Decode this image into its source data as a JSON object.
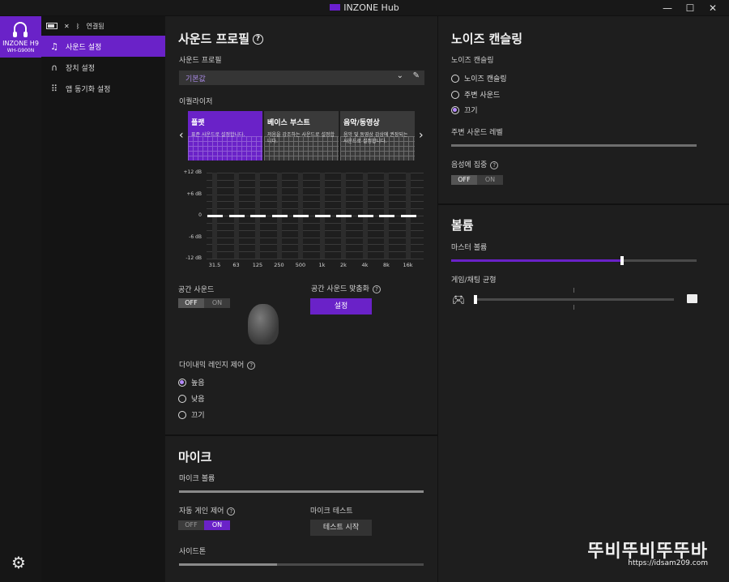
{
  "window": {
    "title": "INZONE Hub",
    "controls": [
      "—",
      "☐",
      "✕"
    ]
  },
  "device": {
    "name": "INZONE H9",
    "model": "WH-G900N"
  },
  "status": {
    "connected": "연결됨"
  },
  "nav": [
    {
      "label": "사운드 설정",
      "icon": "music-note-icon",
      "active": true
    },
    {
      "label": "장치 설정",
      "icon": "headphone-icon",
      "active": false
    },
    {
      "label": "앱 동기화 설정",
      "icon": "grid-icon",
      "active": false
    }
  ],
  "sound_profile": {
    "title": "사운드 프로필",
    "profile_label": "사운드 프로필",
    "profile_value": "기본값",
    "equalizer_label": "이퀄라이저",
    "cards": [
      {
        "title": "플랫",
        "desc": "표준 사운드로 설정합니다.",
        "selected": true
      },
      {
        "title": "베이스 부스트",
        "desc": "저음을 강조하는 사운드로 설정합니다.",
        "selected": false
      },
      {
        "title": "음악/동영상",
        "desc": "음악 및 동영상 감상에 권장되는 사운드로 설정합니다.",
        "selected": false
      }
    ],
    "eq_y_labels": [
      "+12 dB",
      "+6 dB",
      "0",
      "-6 dB",
      "-12 dB"
    ],
    "eq_bands": [
      "31.5",
      "63",
      "125",
      "250",
      "500",
      "1k",
      "2k",
      "4k",
      "8k",
      "16k"
    ],
    "eq_values_db": [
      0,
      0,
      0,
      0,
      0,
      0,
      0,
      0,
      0,
      0
    ],
    "spatial_label": "공간 사운드",
    "spatial_toggle": {
      "off": "OFF",
      "on": "ON",
      "state": "off"
    },
    "spatial_opt_label": "공간 사운드 맞춤화",
    "spatial_opt_button": "설정",
    "drc_label": "다이내믹 레인지 제어",
    "drc_options": [
      "높음",
      "낮음",
      "끄기"
    ],
    "drc_selected": 0
  },
  "mic": {
    "title": "마이크",
    "volume_label": "마이크 볼륨",
    "volume_level": 1.0,
    "agc_label": "자동 게인 제어",
    "agc_toggle": {
      "off": "OFF",
      "on": "ON",
      "state": "on"
    },
    "test_label": "마이크 테스트",
    "test_button": "테스트 시작",
    "sidetone_label": "사이드톤",
    "sidetone_level": 0.4
  },
  "noise_canceling": {
    "title": "노이즈 캔슬링",
    "label": "노이즈 캔슬링",
    "options": [
      "노이즈 캔슬링",
      "주변 사운드",
      "끄기"
    ],
    "selected": 2,
    "ambient_level_label": "주변 사운드 레벨",
    "ambient_level": 1.0,
    "voice_focus_label": "음성에 집중",
    "voice_focus_toggle": {
      "off": "OFF",
      "on": "ON",
      "state": "off"
    }
  },
  "volume": {
    "title": "볼륨",
    "master_label": "마스터 볼륨",
    "master_level": 0.7,
    "balance_label": "게임/채팅 균형",
    "balance_level": 0.0
  },
  "watermark": {
    "text": "뚜비뚜비뚜뚜바",
    "url": "https://idsam209.com"
  }
}
